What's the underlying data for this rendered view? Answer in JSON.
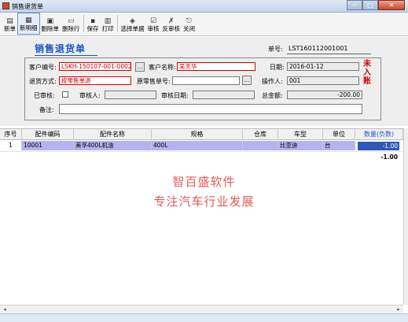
{
  "window": {
    "title": "销售退货单",
    "minimize": "─",
    "maximize": "□",
    "close": "✕"
  },
  "toolbar": {
    "buttons": [
      {
        "label": "新单",
        "icon": "new-doc-icon",
        "glyph": "▤"
      },
      {
        "label": "新明细",
        "icon": "new-detail-icon",
        "glyph": "▦"
      },
      {
        "label": "删除单",
        "icon": "delete-doc-icon",
        "glyph": "▣"
      },
      {
        "label": "删除行",
        "icon": "delete-row-icon",
        "glyph": "▭"
      },
      {
        "label": "保存",
        "icon": "save-icon",
        "glyph": "▪"
      },
      {
        "label": "打印",
        "icon": "print-icon",
        "glyph": "▥"
      },
      {
        "label": "选择单据",
        "icon": "select-doc-icon",
        "glyph": "◈"
      },
      {
        "label": "审核",
        "icon": "approve-icon",
        "glyph": "☑"
      },
      {
        "label": "反审核",
        "icon": "unapprove-icon",
        "glyph": "✗"
      },
      {
        "label": "关闭",
        "icon": "close-icon",
        "glyph": "⎋"
      }
    ]
  },
  "form": {
    "title": "销售退货单",
    "order_no_label": "单号:",
    "order_no": "LST160112001001",
    "customer_code_label": "客户编号:",
    "customer_code": "LSKH-150107-001-0002",
    "customer_name_label": "客户名称:",
    "customer_name": "吴天华",
    "date_label": "日期:",
    "date": "2016-01-12",
    "return_method_label": "退货方式:",
    "return_method": "按零售单退",
    "retail_no_label": "原零售单号:",
    "retail_no": "",
    "operator_label": "操作人:",
    "operator": "001",
    "approved_label": "已审核:",
    "approver_label": "审核人:",
    "approver": "",
    "approve_date_label": "审核日期:",
    "approve_date": "",
    "total_label": "总金额:",
    "total": "-200.00",
    "remark_label": "备注:",
    "remark": "",
    "stamp": "未入账",
    "pick_glyph": "…"
  },
  "table": {
    "columns": [
      "序号",
      "配件编码",
      "配件名称",
      "规格",
      "仓库",
      "车型",
      "单位",
      "数量(负数)"
    ],
    "rows": [
      {
        "no": "1",
        "code": "10001",
        "name": "美孚400L机油",
        "spec": "400L",
        "warehouse": "",
        "car": "比亚迪",
        "unit": "台",
        "qty": "-1.00"
      }
    ],
    "sum_qty": "-1.00"
  },
  "watermark": {
    "line1": "智百盛软件",
    "line2": "专注汽车行业发展"
  },
  "scroll": {
    "left": "◂",
    "right": "▸"
  },
  "colors": {
    "accent_blue": "#1a55c9",
    "stamp_red": "#d00000",
    "row_highlight": "#b3b3f2",
    "selected_cell": "#2f58b9",
    "watermark": "#e35a55"
  }
}
